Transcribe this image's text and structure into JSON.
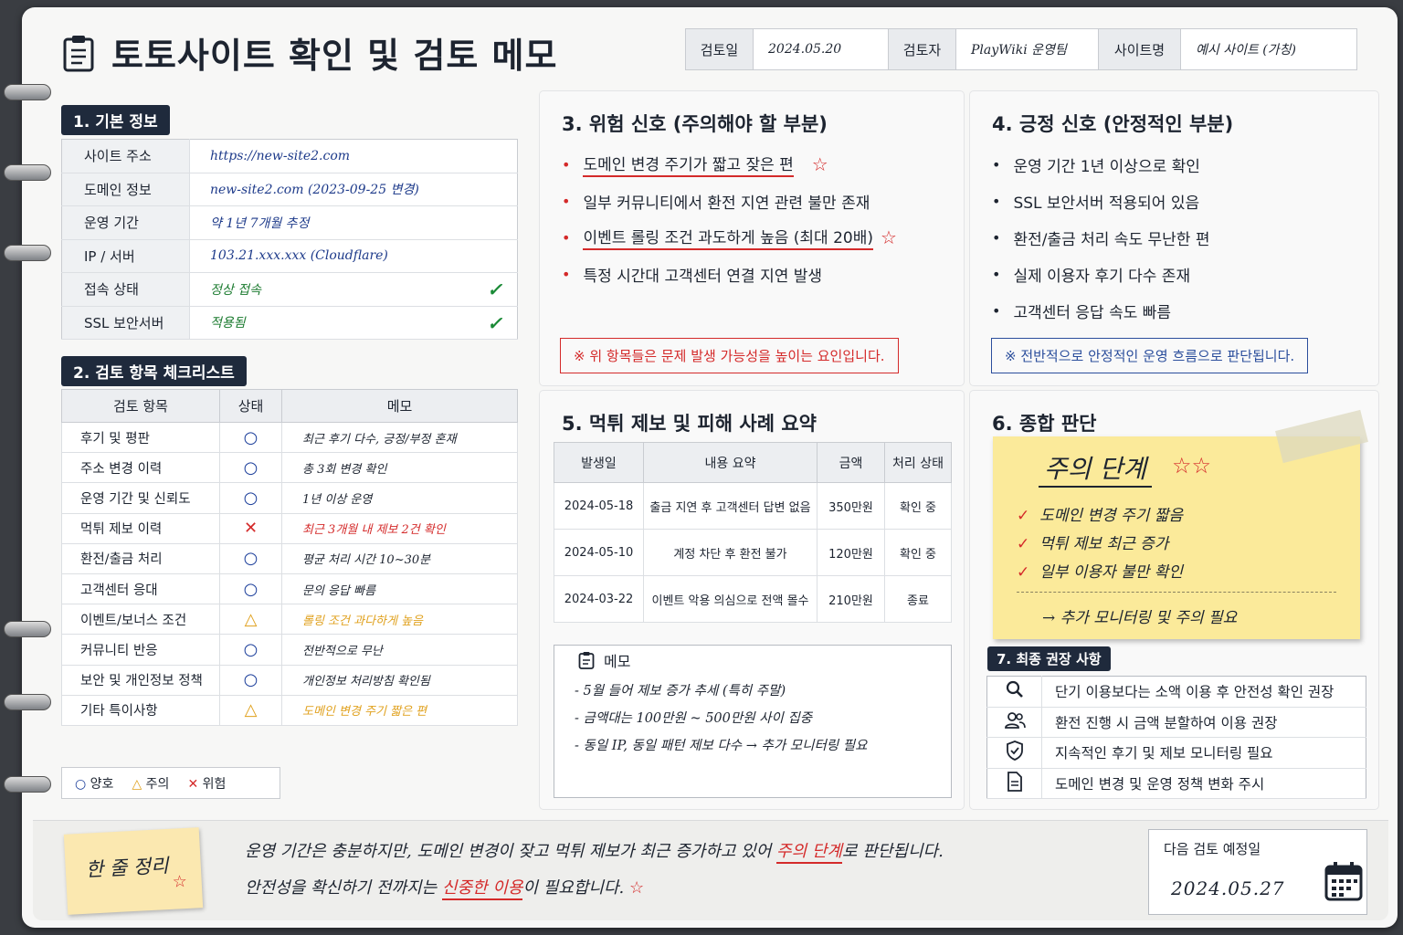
{
  "title": "토토사이트 확인 및 검토 메모",
  "meta": {
    "review_date_label": "검토일",
    "review_date": "2024.05.20",
    "reviewer_label": "검토자",
    "reviewer": "PlayWiki 운영팀",
    "site_label": "사이트명",
    "site": "예시 사이트 (가칭)"
  },
  "basic": {
    "heading": "1. 기본 정보",
    "rows": [
      {
        "k": "사이트 주소",
        "v": "https://new-site2.com"
      },
      {
        "k": "도메인 정보",
        "v": "new-site2.com (2023-09-25 변경)"
      },
      {
        "k": "운영 기간",
        "v": "약 1년 7개월 추정"
      },
      {
        "k": "IP / 서버",
        "v": "103.21.xxx.xxx (Cloudflare)"
      },
      {
        "k": "접속 상태",
        "v": "정상 접속"
      },
      {
        "k": "SSL 보안서버",
        "v": "적용됨"
      }
    ]
  },
  "checklist": {
    "heading": "2. 검토 항목 체크리스트",
    "headers": [
      "검토 항목",
      "상태",
      "메모"
    ],
    "rows": [
      {
        "item": "후기 및 평판",
        "status": "○",
        "memo": "최근 후기 다수, 긍정/부정 혼재"
      },
      {
        "item": "주소 변경 이력",
        "status": "○",
        "memo": "총 3회 변경 확인"
      },
      {
        "item": "운영 기간 및 신뢰도",
        "status": "○",
        "memo": "1년 이상 운영"
      },
      {
        "item": "먹튀 제보 이력",
        "status": "✕",
        "memo": "최근 3개월 내 제보 2건 확인"
      },
      {
        "item": "환전/출금 처리",
        "status": "○",
        "memo": "평균 처리 시간 10~30분"
      },
      {
        "item": "고객센터 응대",
        "status": "○",
        "memo": "문의 응답 빠름"
      },
      {
        "item": "이벤트/보너스 조건",
        "status": "△",
        "memo": "롤링 조건 과다하게 높음"
      },
      {
        "item": "커뮤니티 반응",
        "status": "○",
        "memo": "전반적으로 무난"
      },
      {
        "item": "보안 및 개인정보 정책",
        "status": "○",
        "memo": "개인정보 처리방침 확인됨"
      },
      {
        "item": "기타 특이사항",
        "status": "△",
        "memo": "도메인 변경 주기 짧은 편"
      }
    ]
  },
  "legend": {
    "good": "양호",
    "caution": "주의",
    "danger": "위험"
  },
  "risk": {
    "heading": "3. 위험 신호 (주의해야 할 부분)",
    "items": [
      "도메인 변경 주기가 짧고 잦은 편",
      "일부 커뮤니티에서 환전 지연 관련 불만 존재",
      "이벤트 롤링 조건 과도하게 높음 (최대 20배)",
      "특정 시간대 고객센터 연결 지연 발생"
    ],
    "note": "※ 위 항목들은 문제 발생 가능성을 높이는 요인입니다."
  },
  "positive": {
    "heading": "4. 긍정 신호 (안정적인 부분)",
    "items": [
      "운영 기간 1년 이상으로 확인",
      "SSL 보안서버 적용되어 있음",
      "환전/출금 처리 속도 무난한 편",
      "실제 이용자 후기 다수 존재",
      "고객센터 응답 속도 빠름"
    ],
    "note": "※ 전반적으로 안정적인 운영 흐름으로 판단됩니다."
  },
  "reports": {
    "heading": "5. 먹튀 제보 및 피해 사례 요약",
    "headers": [
      "발생일",
      "내용 요약",
      "금액",
      "처리 상태"
    ],
    "rows": [
      [
        "2024-05-18",
        "출금 지연 후 고객센터 답변 없음",
        "350만원",
        "확인 중"
      ],
      [
        "2024-05-10",
        "계정 차단 후 환전 불가",
        "120만원",
        "확인 중"
      ],
      [
        "2024-03-22",
        "이벤트 악용 의심으로 전액 몰수",
        "210만원",
        "종료"
      ]
    ],
    "memo_label": "메모",
    "memo": [
      "- 5월 들어 제보 증가 추세 (특히 주말)",
      "- 금액대는 100만원 ~ 500만원 사이 집중",
      "- 동일 IP, 동일 패턴 제보 다수 → 추가 모니터링 필요"
    ]
  },
  "overall": {
    "heading": "6. 종합 판단",
    "level": "주의 단계",
    "items": [
      "도메인 변경 주기 짧음",
      "먹튀 제보 최근 증가",
      "일부 이용자 불만 확인"
    ],
    "conclusion": "→ 추가 모니터링 및 주의 필요"
  },
  "recommend": {
    "heading": "7. 최종 권장 사항",
    "items": [
      {
        "icon": "search-icon",
        "text": "단기 이용보다는 소액 이용 후 안전성 확인 권장"
      },
      {
        "icon": "users-icon",
        "text": "환전 진행 시 금액 분할하여 이용 권장"
      },
      {
        "icon": "shield-icon",
        "text": "지속적인 후기 및 제보 모니터링 필요"
      },
      {
        "icon": "document-icon",
        "text": "도메인 변경 및 운영 정책 변화 주시"
      }
    ]
  },
  "summary": {
    "label": "한 줄 정리",
    "line1_a": "운영 기간은 충분하지만, 도메인 변경이 잦고 먹튀 제보가 최근 증가하고 있어 ",
    "line1_b": "주의 단계",
    "line1_c": "로 판단됩니다.",
    "line2_a": "안전성을 확신하기 전까지는 ",
    "line2_b": "신중한 이용",
    "line2_c": "이 필요합니다."
  },
  "next": {
    "label": "다음 검토 예정일",
    "date": "2024.05.27"
  },
  "colors": {
    "accent_red": "#d42a2a",
    "navy": "#1f2a3c",
    "good": "#1a3d9a",
    "caution": "#e0a11e",
    "sticky": "#fbea9a"
  }
}
